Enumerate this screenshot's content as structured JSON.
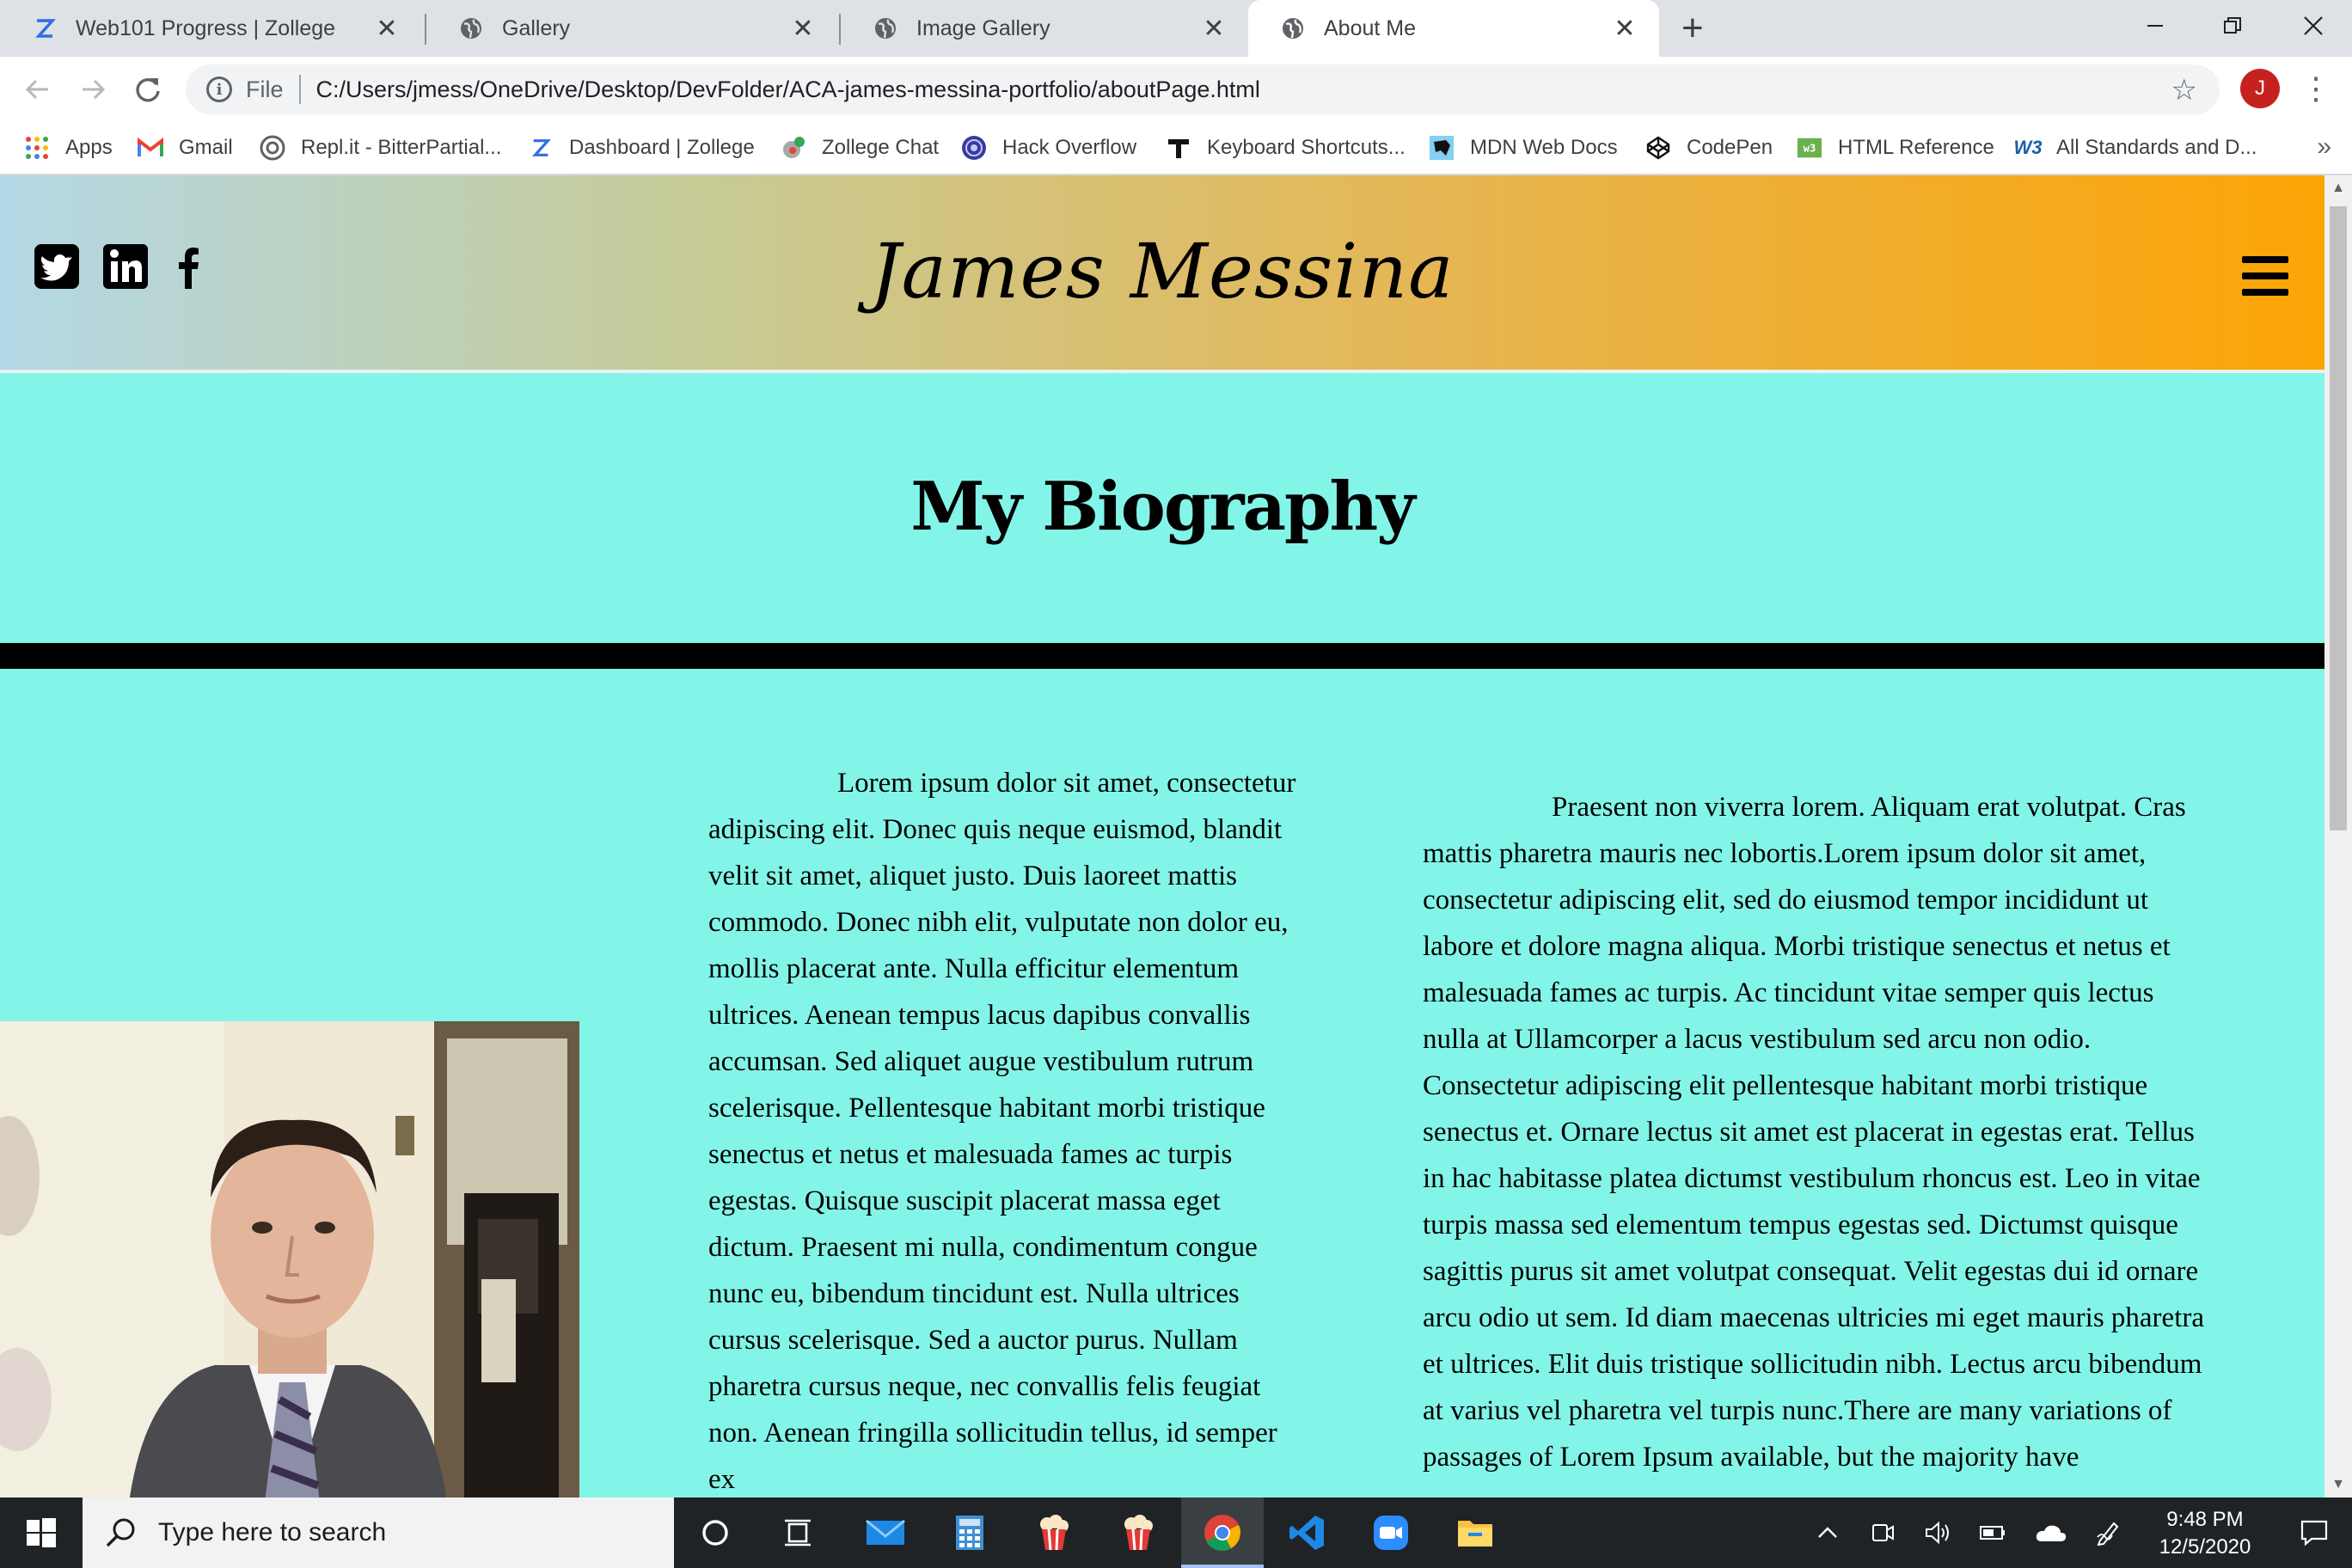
{
  "browser": {
    "tabs": [
      {
        "title": "Web101 Progress | Zollege",
        "icon": "zollege-icon",
        "active": false
      },
      {
        "title": "Gallery",
        "icon": "globe-icon",
        "active": false
      },
      {
        "title": "Image Gallery",
        "icon": "globe-icon",
        "active": false
      },
      {
        "title": "About Me",
        "icon": "globe-icon",
        "active": true
      }
    ],
    "address": {
      "scheme": "File",
      "url": "C:/Users/jmess/OneDrive/Desktop/DevFolder/ACA-james-messina-portfolio/aboutPage.html"
    },
    "profile_initial": "J",
    "bookmarks": [
      {
        "label": "Apps",
        "icon": "apps-grid-icon"
      },
      {
        "label": "Gmail",
        "icon": "gmail-icon"
      },
      {
        "label": "Repl.it - BitterPartial...",
        "icon": "replit-icon"
      },
      {
        "label": "Dashboard | Zollege",
        "icon": "zollege-icon"
      },
      {
        "label": "Zollege Chat",
        "icon": "chat-icon"
      },
      {
        "label": "Hack Overflow",
        "icon": "hack-overflow-icon"
      },
      {
        "label": "Keyboard Shortcuts...",
        "icon": "keyboard-icon"
      },
      {
        "label": "MDN Web Docs",
        "icon": "mdn-icon"
      },
      {
        "label": "CodePen",
        "icon": "codepen-icon"
      },
      {
        "label": "HTML Reference",
        "icon": "html-reference-icon"
      },
      {
        "label": "All Standards and D...",
        "icon": "w3c-icon"
      }
    ],
    "bookmarks_overflow": "»"
  },
  "page": {
    "header": {
      "site_name": "James Messina",
      "social": [
        "twitter-icon",
        "linkedin-icon",
        "facebook-icon"
      ],
      "gradient": [
        "#b3d8e6",
        "#fca405"
      ]
    },
    "heading": "My Biography",
    "background": "#83f5e8",
    "bio_column_1": "Lorem ipsum dolor sit amet, consectetur adipiscing elit. Donec quis neque euismod, blandit velit sit amet, aliquet justo. Duis laoreet mattis commodo. Donec nibh elit, vulputate non dolor eu, mollis placerat ante. Nulla efficitur elementum ultrices. Aenean tempus lacus dapibus convallis accumsan. Sed aliquet augue vestibulum rutrum scelerisque. Pellentesque habitant morbi tristique senectus et netus et malesuada fames ac turpis egestas. Quisque suscipit placerat massa eget dictum. Praesent mi nulla, condimentum congue nunc eu, bibendum tincidunt est. Nulla ultrices cursus scelerisque. Sed a auctor purus. Nullam pharetra cursus neque, nec convallis felis feugiat non. Aenean fringilla sollicitudin tellus, id semper ex",
    "bio_column_2": "Praesent non viverra lorem. Aliquam erat volutpat. Cras mattis pharetra mauris nec lobortis.Lorem ipsum dolor sit amet, consectetur adipiscing elit, sed do eiusmod tempor incididunt ut labore et dolore magna aliqua. Morbi tristique senectus et netus et malesuada fames ac turpis. Ac tincidunt vitae semper quis lectus nulla at Ullamcorper a lacus vestibulum sed arcu non odio. Consectetur adipiscing elit pellentesque habitant morbi tristique senectus et. Ornare lectus sit amet est placerat in egestas erat. Tellus in hac habitasse platea dictumst vestibulum rhoncus est. Leo in vitae turpis massa sed elementum tempus egestas sed. Dictumst quisque sagittis purus sit amet volutpat consequat. Velit egestas dui id ornare arcu odio ut sem. Id diam maecenas ultricies mi eget mauris pharetra et ultrices. Elit duis tristique sollicitudin nibh. Lectus arcu bibendum at varius vel pharetra vel turpis nunc.There are many variations of passages of Lorem Ipsum available, but the majority have"
  },
  "taskbar": {
    "search_placeholder": "Type here to search",
    "time": "9:48 PM",
    "date": "12/5/2020",
    "pinned": [
      "cortana-icon",
      "task-view-icon",
      "mail-icon",
      "calculator-icon",
      "popcorn-time-icon",
      "popcorn-time-alt-icon",
      "chrome-icon",
      "vscode-icon",
      "zoom-icon",
      "file-explorer-icon"
    ],
    "tray": [
      "chevron-up-icon",
      "meet-now-icon",
      "volume-icon",
      "battery-icon",
      "onedrive-icon",
      "pen-icon"
    ]
  }
}
